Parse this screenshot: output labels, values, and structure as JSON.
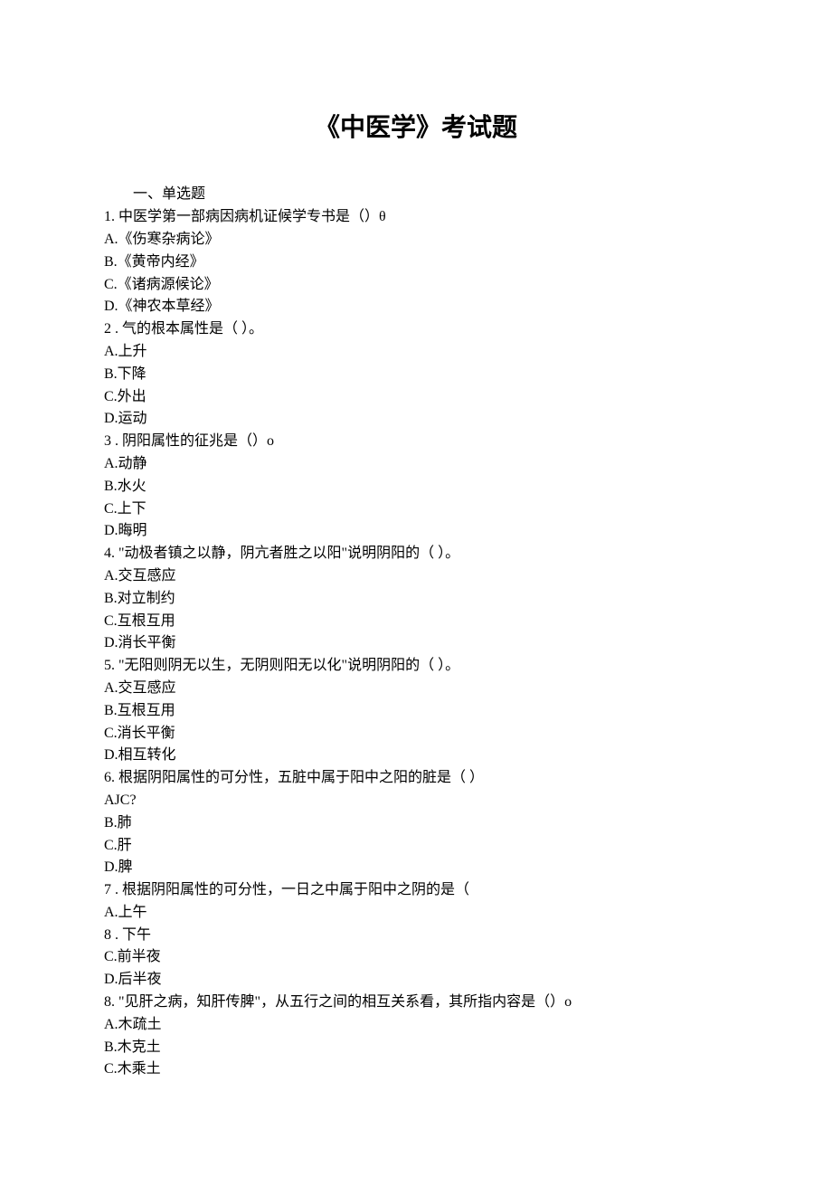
{
  "title": "《中医学》考试题",
  "section": "一、单选题",
  "lines": [
    "1. 中医学第一部病因病机证候学专书是（）θ",
    "A.《伤寒杂病论》",
    "B.《黄帝内经》",
    "C.《诸病源候论》",
    "D.《神农本草经》",
    "2  . 气的根本属性是（   ）。",
    "A.上升",
    "B.下降",
    "C.外出",
    "D.运动",
    "3  . 阴阳属性的征兆是（）o",
    "A.动静",
    "B.水火",
    "C.上下",
    "D.晦明",
    "4.   \"动极者镇之以静，阴亢者胜之以阳\"说明阴阳的（    ）。",
    "A.交互感应",
    "B.对立制约",
    "C.互根互用",
    "D.消长平衡",
    "5.   \"无阳则阴无以生，无阴则阳无以化\"说明阴阳的（    ）。",
    "A.交互感应",
    "B.互根互用",
    "C.消长平衡",
    "D.相互转化",
    "6.  根据阴阳属性的可分性，五脏中属于阳中之阳的脏是（    ）",
    "AJC?",
    "B.肺",
    "C.肝",
    "D.脾",
    "7  . 根据阴阳属性的可分性，一日之中属于阳中之阴的是（",
    "A.上午",
    "8  . 下午",
    "C.前半夜",
    "D.后半夜",
    "8.   \"见肝之病，知肝传脾\"，从五行之间的相互关系看，其所指内容是（）o",
    "A.木疏土",
    "B.木克土",
    "C.木乘土"
  ]
}
